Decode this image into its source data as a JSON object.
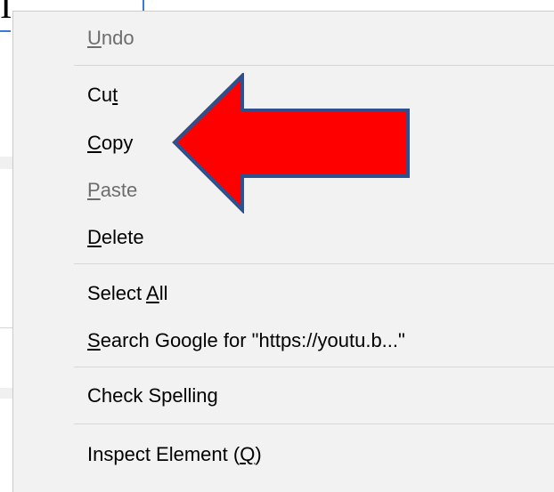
{
  "menu": {
    "items": [
      {
        "id": "undo",
        "label": "Undo",
        "mnemonic_index": 0,
        "enabled": false
      },
      {
        "id": "cut",
        "label": "Cut",
        "mnemonic_index": 2,
        "enabled": true
      },
      {
        "id": "copy",
        "label": "Copy",
        "mnemonic_index": 0,
        "enabled": true
      },
      {
        "id": "paste",
        "label": "Paste",
        "mnemonic_index": 0,
        "enabled": false
      },
      {
        "id": "delete",
        "label": "Delete",
        "mnemonic_index": 0,
        "enabled": true
      },
      {
        "id": "select-all",
        "label": "Select All",
        "mnemonic_index": 7,
        "enabled": true
      },
      {
        "id": "search-google",
        "label": "Search Google for \"https://youtu.b...\"",
        "mnemonic_index": 0,
        "enabled": true
      },
      {
        "id": "check-spelling",
        "label": "Check Spelling",
        "mnemonic_index": 13,
        "enabled": true
      },
      {
        "id": "inspect-element",
        "label": "Inspect Element (Q)",
        "mnemonic_index": 17,
        "enabled": true
      }
    ]
  },
  "annotation": {
    "icon": "red-arrow-icon",
    "points_to": "copy",
    "fill": "#ff0000",
    "stroke": "#2f4f8f"
  },
  "colors": {
    "menu_bg": "#f2f2f2",
    "disabled_text": "#6d6d6d",
    "separator": "#d7d7d7"
  }
}
